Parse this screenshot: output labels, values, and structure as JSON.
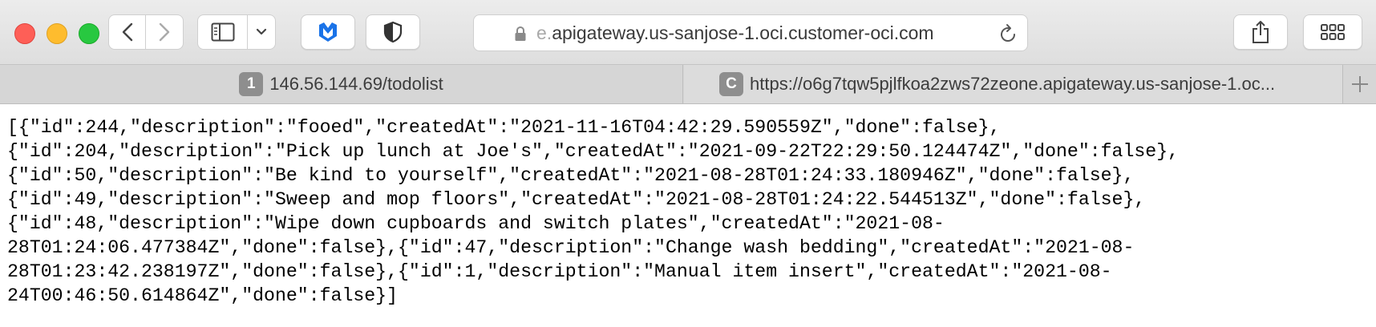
{
  "toolbar": {
    "address_prefix": "e.",
    "address_main": "apigateway.us-sanjose-1.oci.customer-oci.com"
  },
  "tabs": [
    {
      "badge": "1",
      "label": "146.56.144.69/todolist"
    },
    {
      "badge": "C",
      "label": "https://o6g7tqw5pjlfkoa2zws72zeone.apigateway.us-sanjose-1.oc..."
    }
  ],
  "content": {
    "lines": [
      "[{\"id\":244,\"description\":\"fooed\",\"createdAt\":\"2021-11-16T04:42:29.590559Z\",\"done\":false},",
      "{\"id\":204,\"description\":\"Pick up lunch at Joe's\",\"createdAt\":\"2021-09-22T22:29:50.124474Z\",\"done\":false},",
      "{\"id\":50,\"description\":\"Be kind to yourself\",\"createdAt\":\"2021-08-28T01:24:33.180946Z\",\"done\":false},",
      "{\"id\":49,\"description\":\"Sweep and mop floors\",\"createdAt\":\"2021-08-28T01:24:22.544513Z\",\"done\":false},",
      "{\"id\":48,\"description\":\"Wipe down cupboards and switch plates\",\"createdAt\":\"2021-08-",
      "28T01:24:06.477384Z\",\"done\":false},{\"id\":47,\"description\":\"Change wash bedding\",\"createdAt\":\"2021-08-",
      "28T01:23:42.238197Z\",\"done\":false},{\"id\":1,\"description\":\"Manual item insert\",\"createdAt\":\"2021-08-",
      "24T00:46:50.614864Z\",\"done\":false}]"
    ]
  },
  "icons": {
    "back": "chevron-left-icon",
    "forward": "chevron-right-icon",
    "sidebar": "sidebar-icon",
    "extension1": "malwarebytes-m-icon",
    "extension2": "shield-icon",
    "lock": "lock-icon",
    "reload": "reload-icon",
    "share": "share-icon",
    "grid": "grid-icon",
    "new_tab": "plus-icon"
  },
  "colors": {
    "close": "#fe5f57",
    "minimize": "#febc2e",
    "zoom": "#28c840",
    "extension_blue": "#1a73e8"
  }
}
